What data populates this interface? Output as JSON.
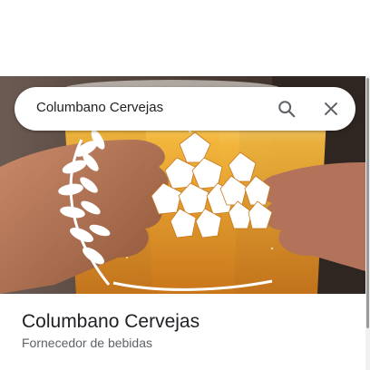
{
  "search": {
    "query": "Columbano Cervejas",
    "search_icon": "search-icon",
    "close_icon": "close-icon"
  },
  "hero": {
    "image_subject": "hands toasting glasses of beer with white hop and wheat logo overlay"
  },
  "place": {
    "name": "Columbano Cervejas",
    "category": "Fornecedor de bebidas"
  },
  "colors": {
    "text_primary": "#202124",
    "text_secondary": "#5f6368",
    "beer": "#e8a12c",
    "icon": "#5f6368"
  }
}
